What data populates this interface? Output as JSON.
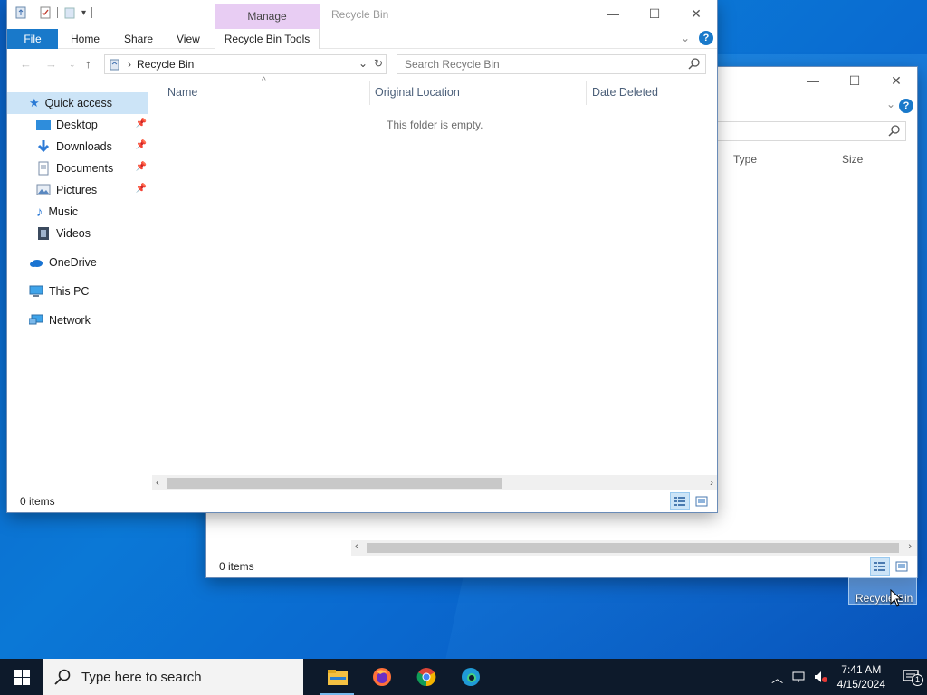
{
  "back_window": {
    "col_type": "Type",
    "col_size": "Size",
    "status": "0 items"
  },
  "front_window": {
    "title": "Recycle Bin",
    "ribbon": {
      "context_group": "Manage",
      "tabs": [
        "File",
        "Home",
        "Share",
        "View",
        "Recycle Bin Tools"
      ]
    },
    "address": "Recycle Bin",
    "search_placeholder": "Search Recycle Bin",
    "nav": {
      "quick_access": "Quick access",
      "pinned": [
        "Desktop",
        "Downloads",
        "Documents",
        "Pictures"
      ],
      "unpinned": [
        "Music",
        "Videos"
      ],
      "onedrive": "OneDrive",
      "this_pc": "This PC",
      "network": "Network"
    },
    "columns": [
      "Name",
      "Original Location",
      "Date Deleted"
    ],
    "empty_message": "This folder is empty.",
    "status": "0 items"
  },
  "desktop_icon": {
    "label": "Recycle Bin"
  },
  "taskbar": {
    "search_placeholder": "Type here to search",
    "time": "7:41 AM",
    "date": "4/15/2024",
    "notification_count": "1"
  },
  "colors": {
    "accent": "#1979ca",
    "manage_tab": "#e8cdf3",
    "selection": "#cce4f7",
    "taskbar": "#0d1a2b"
  }
}
